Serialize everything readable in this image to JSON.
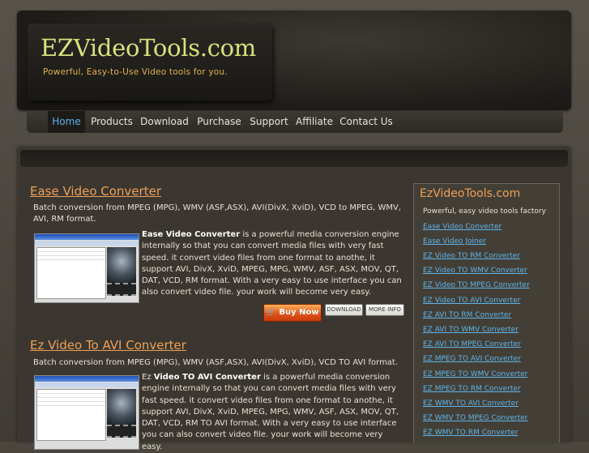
{
  "header": {
    "title": "EZVideoTools.com",
    "tagline": "Powerful, Easy-to-Use Video tools for you."
  },
  "nav": {
    "items": [
      {
        "label": "Home",
        "active": true
      },
      {
        "label": "Products"
      },
      {
        "label": "Download"
      },
      {
        "label": "Purchase"
      },
      {
        "label": "Support"
      },
      {
        "label": "Affiliate"
      },
      {
        "label": "Contact Us"
      }
    ]
  },
  "products": [
    {
      "title": "Ease Video Converter",
      "summary": "Batch conversion from MPEG (MPG), WMV (ASF,ASX), AVI(DivX, XviD), VCD to MPEG, WMV, AVI, RM format.",
      "desc_bold": "Ease Video Converter",
      "desc_rest": " is a powerful media conversion engine internally so that you can convert media files with very fast speed. it convert video files from one format to anothe, it support AVI, DivX, XviD, MPEG, MPG, WMV, ASF, ASX, MOV, QT, DAT, VCD, RM format. With a very easy to use interface you can also convert video file. your work will become very easy.",
      "buy_label": "Buy Now",
      "download_label": "DOWNLOAD",
      "more_label": "MORE INFO"
    },
    {
      "title": "Ez Video To AVI Converter",
      "summary": "Batch conversion from MPEG (MPG), WMV (ASF,ASX), AVI(DivX, XviD), VCD TO AVI format.",
      "desc_prefix": "Ez ",
      "desc_bold": "Video TO AVI Converter",
      "desc_rest": " is a powerful media conversion engine internally so that you can convert media files with very fast speed. it convert video files from one format to anothe, it support AVI, DivX, XviD, MPEG, MPG, WMV, ASF, ASX, MOV, QT, DAT, VCD, RM TO AVI format. With a very easy to use interface you can also convert video file. your work will become very easy."
    }
  ],
  "sidebar": {
    "title": "EzVideoTools.com",
    "subtitle": "Powerful, easy video tools factory",
    "links": [
      "Ease Video Converter",
      "Ease Video Joiner",
      "EZ Video TO RM Converter",
      "EZ Video TO WMV Converter",
      "EZ Video TO MPEG Converter",
      "EZ Video TO AVI Converter",
      "EZ AVI TO RM Converter",
      "EZ AVI TO WMV Converter",
      "EZ AVI TO MPEG Converter",
      "EZ MPEG TO AVI Converter",
      "EZ MPEG TO WMV Converter",
      "EZ MPEG TO RM Converter",
      "EZ WMV TO AVI Converter",
      "EZ WMV TO MPEG Converter",
      "EZ WMV TO RM Converter"
    ]
  },
  "colors": {
    "accent_orange": "#ef9f58",
    "link_blue": "#5fb4e9",
    "title_yellow": "#d9e07c"
  }
}
